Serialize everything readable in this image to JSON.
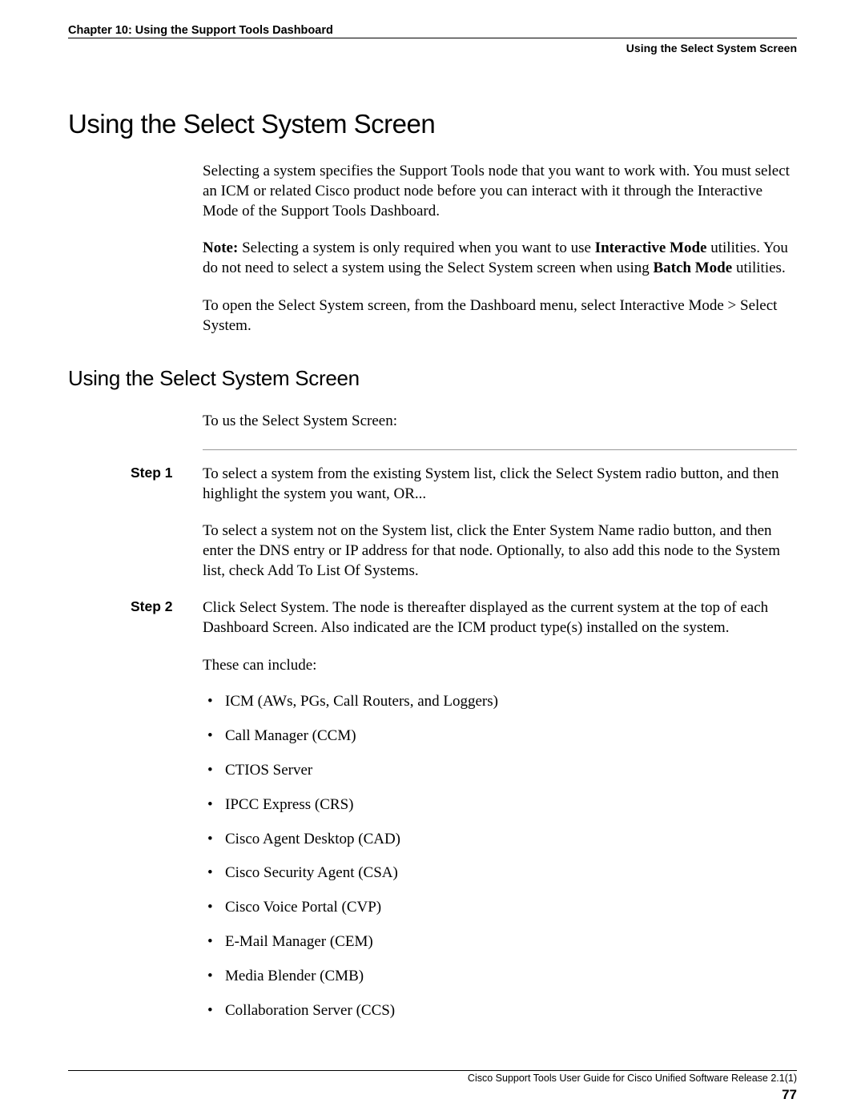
{
  "header": {
    "chapter": "Chapter 10: Using the Support Tools Dashboard",
    "section": "Using the Select System Screen"
  },
  "h1": "Using the Select System Screen",
  "intro": {
    "p1": "Selecting a system specifies the Support Tools node that you want to work with. You must select an ICM or related Cisco product node before you can interact with it through the Interactive Mode of the Support Tools Dashboard.",
    "note_label": "Note:",
    "note_text_1": " Selecting a system is only required when you want to use ",
    "note_bold_1": "Interactive Mode",
    "note_text_2": " utilities. You do not need to select a system using the Select System screen when using ",
    "note_bold_2": "Batch Mode",
    "note_text_3": " utilities.",
    "p3": "To open the Select System screen, from the Dashboard menu, select Interactive Mode > Select System."
  },
  "h2": "Using the Select System Screen",
  "subintro": "To us the Select System Screen:",
  "steps": {
    "s1_label": "Step 1",
    "s1_p1": "To select a system from the existing System list, click the Select System radio button, and then highlight the system you want, OR...",
    "s1_p2": "To select a system not on the System list, click the Enter System Name radio button, and then enter the DNS entry or IP address for that node. Optionally, to also add this node to the System list, check Add To List Of Systems.",
    "s2_label": "Step 2",
    "s2_p1": "Click Select System. The node is thereafter displayed as the current system at the top of each Dashboard Screen. Also indicated are the ICM product type(s) installed on the system.",
    "s2_p2": "These can include:"
  },
  "products": [
    "ICM (AWs, PGs, Call Routers, and Loggers)",
    "Call Manager (CCM)",
    "CTIOS Server",
    "IPCC Express (CRS)",
    "Cisco Agent Desktop (CAD)",
    "Cisco Security Agent (CSA)",
    "Cisco Voice Portal (CVP)",
    "E-Mail Manager (CEM)",
    "Media Blender (CMB)",
    "Collaboration Server (CCS)"
  ],
  "footer": {
    "doc": "Cisco Support Tools User Guide for Cisco Unified Software Release 2.1(1)",
    "page": "77"
  }
}
